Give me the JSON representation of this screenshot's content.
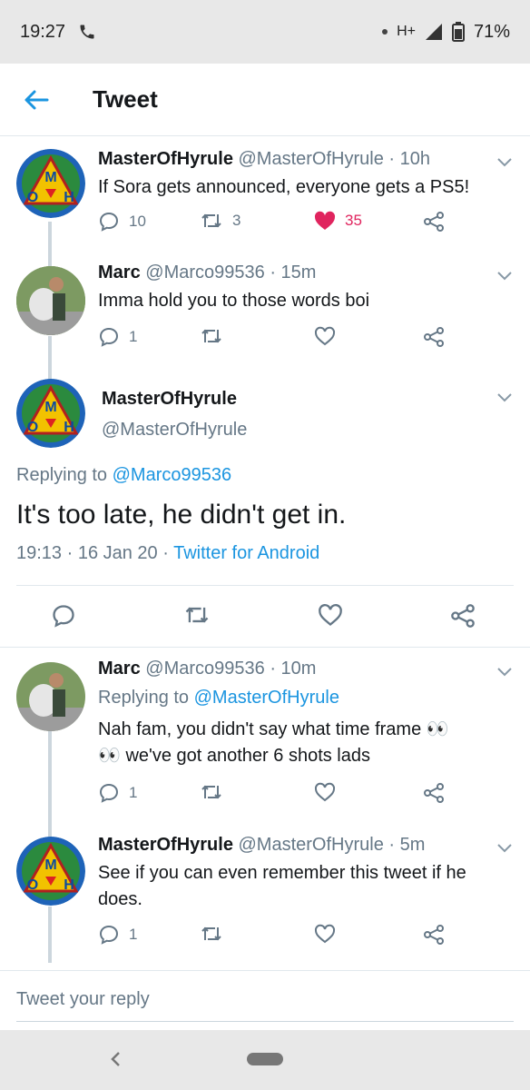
{
  "status_bar": {
    "time": "19:27",
    "network": "H+",
    "battery": "71%"
  },
  "app_bar": {
    "title": "Tweet"
  },
  "tweets": [
    {
      "name": "MasterOfHyrule",
      "handle": "@MasterOfHyrule",
      "time": "· 10h",
      "text": "If Sora gets announced,  everyone gets a PS5!",
      "replies": "10",
      "retweets": "3",
      "likes": "35"
    },
    {
      "name": "Marc",
      "handle": "@Marco99536",
      "time": "· 15m",
      "text": "Imma hold you to those words boi",
      "replies": "1"
    },
    {
      "name": "Marc",
      "handle": "@Marco99536",
      "time": "· 10m",
      "replying_prefix": "Replying to ",
      "replying_to": "@MasterOfHyrule",
      "text_line1": "Nah fam, you didn't say what time frame 👀",
      "text_line2": "👀 we've got another 6 shots lads",
      "replies": "1"
    },
    {
      "name": "MasterOfHyrule",
      "handle": "@MasterOfHyrule",
      "time": "· 5m",
      "text": "See if you can even remember this tweet if he does.",
      "replies": "1"
    }
  ],
  "main_tweet": {
    "name": "MasterOfHyrule",
    "handle": "@MasterOfHyrule",
    "replying_prefix": "Replying to ",
    "replying_to": "@Marco99536",
    "text": "It's too late, he didn't get in.",
    "timestamp": "19:13 · 16 Jan 20 · ",
    "source": "Twitter for Android"
  },
  "reply_box": {
    "placeholder": "Tweet your reply"
  },
  "colors": {
    "accent": "#1b95e0",
    "like": "#e0245e",
    "muted": "#657786"
  },
  "icons": [
    "phone-icon",
    "signal-icon",
    "battery-icon",
    "back-arrow-icon",
    "chevron-down-icon",
    "reply-icon",
    "retweet-icon",
    "like-icon",
    "share-icon"
  ]
}
